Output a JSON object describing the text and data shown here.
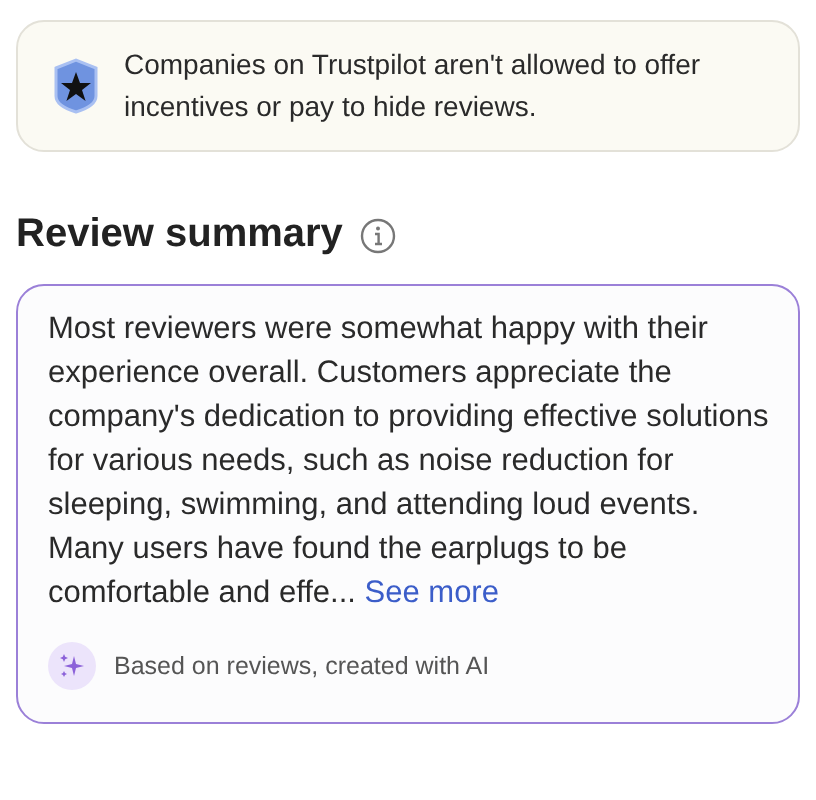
{
  "notice": {
    "text": "Companies on Trustpilot aren't allowed to offer incentives or pay to hide reviews."
  },
  "summary": {
    "title": "Review summary",
    "text": "Most reviewers were somewhat happy with their experience overall. Customers appreciate the company's dedication to providing effective solutions for various needs, such as noise reduction for sleeping, swimming, and attending loud events. Many users have found the earplugs to be comfortable and effe...",
    "link": "See more",
    "footer": "Based on reviews, created with AI"
  }
}
